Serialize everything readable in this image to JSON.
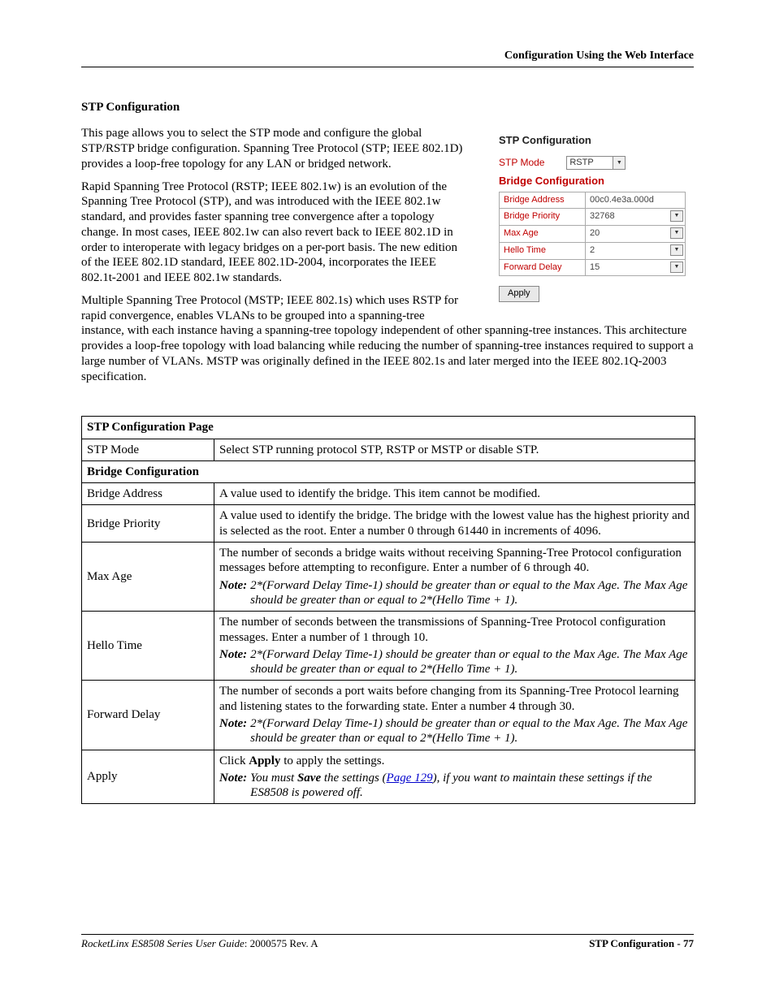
{
  "header": {
    "right": "Configuration Using the Web Interface"
  },
  "section": {
    "title": "STP Configuration"
  },
  "paras": {
    "p1": "This page allows you to select the STP mode and configure the global STP/RSTP bridge configuration. Spanning Tree Protocol (STP; IEEE 802.1D) provides a loop-free topology for any LAN or bridged network.",
    "p2": "Rapid Spanning Tree Protocol (RSTP; IEEE 802.1w) is an evolution of the Spanning Tree Protocol (STP), and was introduced with the IEEE 802.1w standard, and provides faster spanning tree convergence after a topology change. In most cases, IEEE 802.1w can also revert back to IEEE 802.1D in order to interoperate with legacy bridges on a per-port basis. The new edition of the IEEE 802.1D standard, IEEE 802.1D-2004, incorporates the IEEE 802.1t-2001 and IEEE 802.1w standards.",
    "p3": "Multiple Spanning Tree Protocol (MSTP; IEEE 802.1s) which uses RSTP for rapid convergence, enables VLANs to be grouped into a spanning-tree instance, with each instance having a spanning-tree topology independent of other spanning-tree instances. This architecture provides a loop-free topology with load balancing while reducing the number of spanning-tree instances required to support a large number of VLANs. MSTP was originally defined in the IEEE 802.1s and later merged into the IEEE 802.1Q-2003 specification."
  },
  "figure": {
    "title": "STP Configuration",
    "mode_label": "STP Mode",
    "mode_value": "RSTP",
    "sub": "Bridge Configuration",
    "rows": {
      "addr_l": "Bridge Address",
      "addr_v": "00c0.4e3a.000d",
      "prio_l": "Bridge Priority",
      "prio_v": "32768",
      "max_l": "Max Age",
      "max_v": "20",
      "hello_l": "Hello Time",
      "hello_v": "2",
      "fwd_l": "Forward Delay",
      "fwd_v": "15"
    },
    "apply": "Apply"
  },
  "table": {
    "caption": "STP Configuration Page",
    "stp_mode_l": "STP Mode",
    "stp_mode_d": "Select STP running protocol STP, RSTP or MSTP or disable STP.",
    "bc_header": "Bridge Configuration",
    "ba_l": "Bridge Address",
    "ba_d": "A value used to identify the bridge. This item cannot be modified.",
    "bp_l": "Bridge Priority",
    "bp_d": "A value used to identify the bridge. The bridge with the lowest value has the highest priority and is selected as the root. Enter a number 0 through 61440 in increments of 4096.",
    "ma_l": "Max Age",
    "ma_d": "The number of seconds a bridge waits without receiving Spanning-Tree Protocol configuration messages before attempting to reconfigure. Enter a number of 6 through 40.",
    "ht_l": "Hello Time",
    "ht_d": "The number of seconds between the transmissions of Spanning-Tree Protocol configuration messages. Enter a number of 1 through 10.",
    "fd_l": "Forward Delay",
    "fd_d": "The number of seconds a port waits before changing from its Spanning-Tree Protocol learning and listening states to the forwarding state. Enter a number 4 through 30.",
    "ap_l": "Apply",
    "ap_d_pre": "Click ",
    "ap_d_b": "Apply",
    "ap_d_post": " to apply the settings.",
    "note_label": "Note:",
    "note_stp": "2*(Forward Delay Time-1) should be greater than or equal to the Max Age. The Max Age should be greater than or equal to 2*(Hello Time + 1).",
    "note_apply_pre": "You must ",
    "note_apply_b": "Save",
    "note_apply_mid": " the settings (",
    "note_apply_link": "Page 129",
    "note_apply_post": "), if you want to maintain these settings if the ES8508 is powered off."
  },
  "footer": {
    "left_i": "RocketLinx ES8508 Series  User Guide",
    "left_r": ": 2000575 Rev. A",
    "right": "STP Configuration - 77"
  }
}
